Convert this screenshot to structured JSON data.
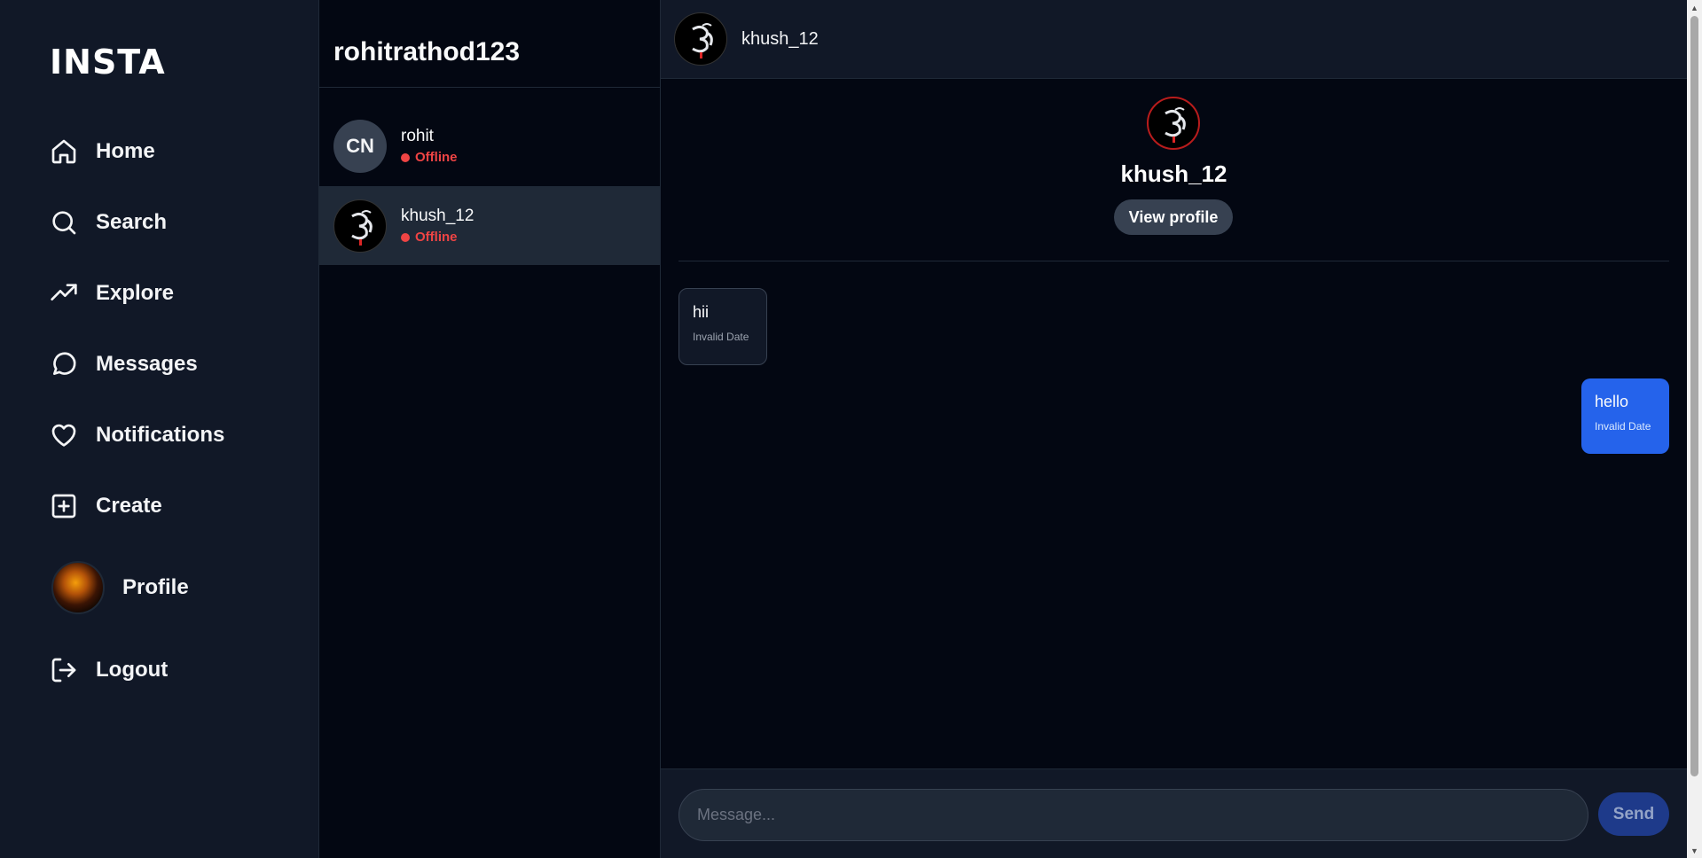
{
  "app": {
    "logo": "INSTA"
  },
  "sidebar": {
    "items": [
      {
        "label": "Home",
        "icon": "home-icon"
      },
      {
        "label": "Search",
        "icon": "search-icon"
      },
      {
        "label": "Explore",
        "icon": "trending-up-icon"
      },
      {
        "label": "Messages",
        "icon": "message-circle-icon"
      },
      {
        "label": "Notifications",
        "icon": "heart-icon"
      },
      {
        "label": "Create",
        "icon": "plus-square-icon"
      },
      {
        "label": "Profile",
        "icon": "avatar"
      },
      {
        "label": "Logout",
        "icon": "logout-icon"
      }
    ]
  },
  "conversations": {
    "username": "rohitrathod123",
    "items": [
      {
        "name": "rohit",
        "initials": "CN",
        "status": "Offline"
      },
      {
        "name": "khush_12",
        "status": "Offline",
        "active": true
      }
    ]
  },
  "chat": {
    "header_name": "khush_12",
    "profile_name": "khush_12",
    "view_profile_label": "View profile",
    "messages": [
      {
        "direction": "incoming",
        "text": "hii",
        "time": "Invalid Date"
      },
      {
        "direction": "outgoing",
        "text": "hello",
        "time": "Invalid Date"
      }
    ],
    "input_placeholder": "Message...",
    "send_label": "Send"
  },
  "colors": {
    "background": "#030712",
    "sidebar": "#111827",
    "outgoing_bubble": "#2563eb",
    "offline": "#ef4444"
  }
}
